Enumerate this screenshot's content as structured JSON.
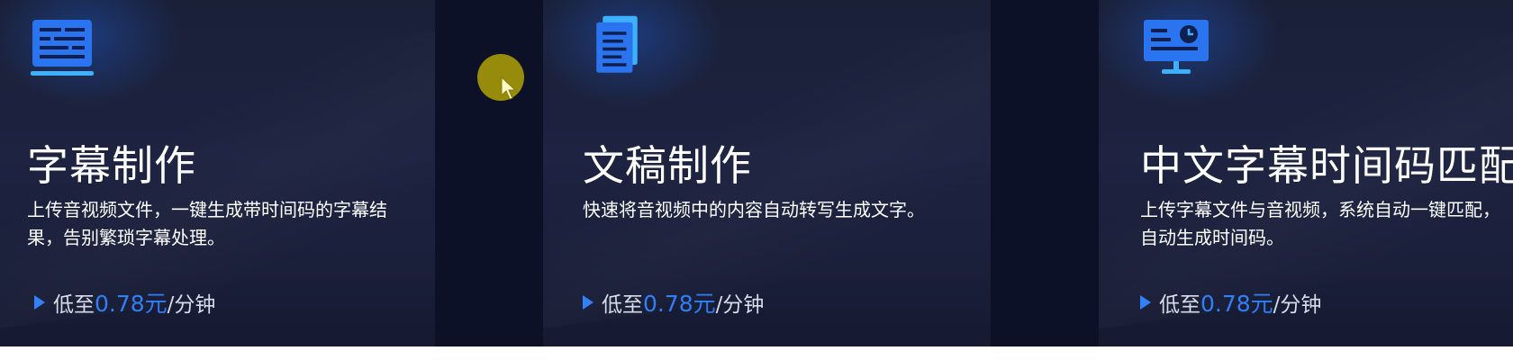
{
  "cards": [
    {
      "title": "字幕制作",
      "description": "上传音视频文件，一键生成带时间码的字幕结果，告别繁琐字幕处理。",
      "price_prefix": "低至",
      "price_value": "0.78元",
      "price_suffix": "/分钟",
      "icon": "subtitle-icon"
    },
    {
      "title": "文稿制作",
      "description": "快速将音视频中的内容自动转写生成文字。",
      "price_prefix": "低至",
      "price_value": "0.78元",
      "price_suffix": "/分钟",
      "icon": "document-icon"
    },
    {
      "title": "中文字幕时间码匹配",
      "description": "上传字幕文件与音视频，系统自动一键匹配，自动生成时间码。",
      "price_prefix": "低至",
      "price_value": "0.78元",
      "price_suffix": "/分钟",
      "icon": "monitor-clock-icon"
    }
  ],
  "colors": {
    "accent": "#2f7df6",
    "background": "#0c1128",
    "card": "#1d2340",
    "cursor_highlight": "#c4b400"
  }
}
